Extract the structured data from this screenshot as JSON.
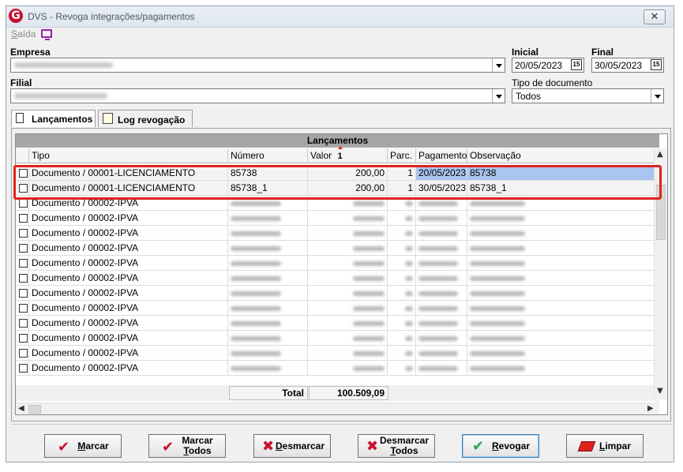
{
  "window": {
    "title": "DVS - Revoga integrações/pagamentos",
    "close_glyph": "✕"
  },
  "menu": {
    "saida_label": "Saída",
    "saida_accel": "S",
    "saida_rest": "aída",
    "monitor_icon": "monitor-icon"
  },
  "filters": {
    "empresa_label": "Empresa",
    "filial_label": "Filial",
    "inicial_label": "Inicial",
    "final_label": "Final",
    "inicial_value": "20/05/2023",
    "final_value": "30/05/2023",
    "calendar_glyph": "15",
    "tipo_documento_label": "Tipo de documento",
    "tipo_documento_value": "Todos"
  },
  "tabs": [
    {
      "label": "Lançamentos",
      "active": true,
      "icon": "page-icon"
    },
    {
      "label": "Log revogação",
      "active": false,
      "icon": "notepad-icon"
    }
  ],
  "grid": {
    "group_header": "Lançamentos",
    "columns": [
      "Tipo",
      "Número",
      "Valor",
      "Parc.",
      "Pagamento",
      "Observação"
    ],
    "sort_indicator": "1",
    "rows": [
      {
        "tipo": "Documento / 00001-LICENCIAMENTO",
        "numero": "85738",
        "valor": "200,00",
        "parc": "1",
        "pagamento": "20/05/2023",
        "observacao": "85738",
        "highlighted": true
      },
      {
        "tipo": "Documento / 00001-LICENCIAMENTO",
        "numero": "85738_1",
        "valor": "200,00",
        "parc": "1",
        "pagamento": "30/05/2023",
        "observacao": "85738_1",
        "highlighted": true
      },
      {
        "tipo": "Documento / 00002-IPVA"
      },
      {
        "tipo": "Documento / 00002-IPVA"
      },
      {
        "tipo": "Documento / 00002-IPVA"
      },
      {
        "tipo": "Documento / 00002-IPVA"
      },
      {
        "tipo": "Documento / 00002-IPVA"
      },
      {
        "tipo": "Documento / 00002-IPVA"
      },
      {
        "tipo": "Documento / 00002-IPVA"
      },
      {
        "tipo": "Documento / 00002-IPVA"
      },
      {
        "tipo": "Documento / 00002-IPVA"
      },
      {
        "tipo": "Documento / 00002-IPVA"
      },
      {
        "tipo": "Documento / 00002-IPVA"
      },
      {
        "tipo": "Documento / 00002-IPVA"
      }
    ],
    "total_label": "Total",
    "total_value": "100.509,09"
  },
  "buttons": [
    {
      "name": "marcar-button",
      "line1": "Marcar",
      "line2": "",
      "icon": "check-icon",
      "color": "#c8102e"
    },
    {
      "name": "marcar-todos-button",
      "line1": "Marcar",
      "line2": "Todos",
      "icon": "check-icon",
      "color": "#c8102e"
    },
    {
      "name": "desmarcar-button",
      "line1": "Desmarcar",
      "line2": "",
      "icon": "x-icon",
      "color": "#c8102e"
    },
    {
      "name": "desmarcar-todos-button",
      "line1": "Desmarcar",
      "line2": "Todos",
      "icon": "x-icon",
      "color": "#c8102e"
    },
    {
      "name": "revogar-button",
      "line1": "Revogar",
      "line2": "",
      "icon": "check-icon",
      "color": "#2aa84a"
    },
    {
      "name": "limpar-button",
      "line1": "Limpar",
      "line2": "",
      "icon": "eraser-icon",
      "color": "#e0211d"
    }
  ],
  "colors": {
    "highlight_border": "#e0211d",
    "selected_cell": "#a9c4ee",
    "group_header_bg": "#a6a6a6"
  }
}
